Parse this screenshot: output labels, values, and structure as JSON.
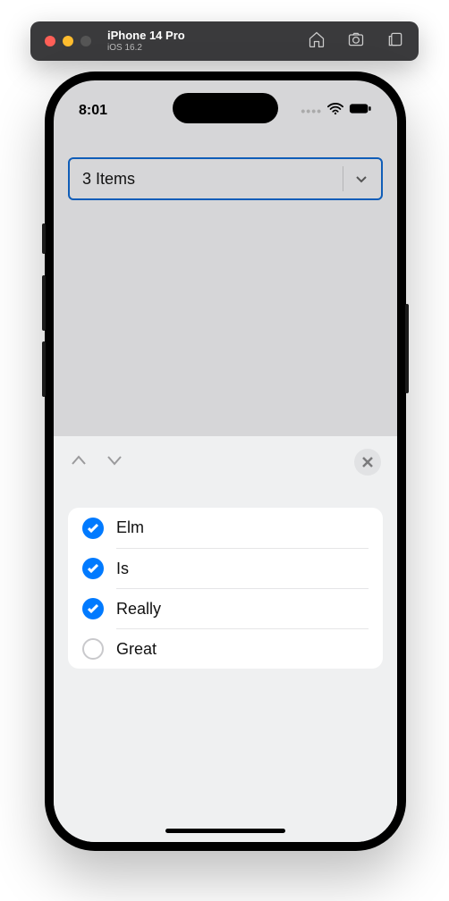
{
  "titlebar": {
    "device": "iPhone 14 Pro",
    "os": "iOS 16.2"
  },
  "statusbar": {
    "time": "8:01"
  },
  "select": {
    "summary": "3 Items"
  },
  "options": [
    {
      "label": "Elm",
      "checked": true
    },
    {
      "label": "Is",
      "checked": true
    },
    {
      "label": "Really",
      "checked": true
    },
    {
      "label": "Great",
      "checked": false
    }
  ]
}
